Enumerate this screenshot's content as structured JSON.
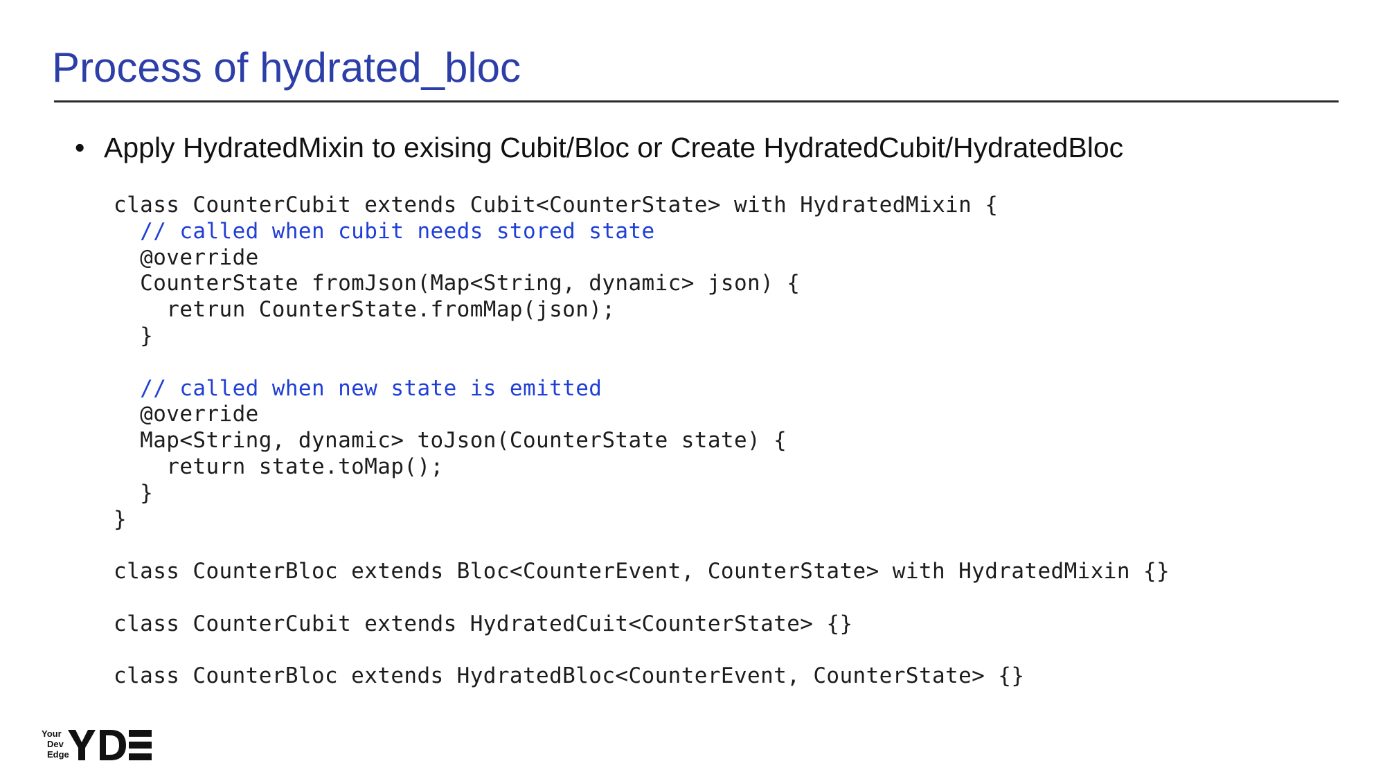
{
  "slide": {
    "title": "Process of hydrated_bloc",
    "bullet": {
      "marker": "•",
      "text": "Apply HydratedMixin to exising Cubit/Bloc or Create HydratedCubit/HydratedBloc"
    }
  },
  "code": {
    "comment_color": "#1f3fd6",
    "lines": [
      {
        "text": "class CounterCubit extends Cubit<CounterState> with HydratedMixin {",
        "comment": false
      },
      {
        "text": "  // called when cubit needs stored state",
        "comment": true
      },
      {
        "text": "  @override",
        "comment": false
      },
      {
        "text": "  CounterState fromJson(Map<String, dynamic> json) {",
        "comment": false
      },
      {
        "text": "    retrun CounterState.fromMap(json);",
        "comment": false
      },
      {
        "text": "  }",
        "comment": false
      },
      {
        "text": "",
        "comment": false
      },
      {
        "text": "  // called when new state is emitted",
        "comment": true
      },
      {
        "text": "  @override",
        "comment": false
      },
      {
        "text": "  Map<String, dynamic> toJson(CounterState state) {",
        "comment": false
      },
      {
        "text": "    return state.toMap();",
        "comment": false
      },
      {
        "text": "  }",
        "comment": false
      },
      {
        "text": "}",
        "comment": false
      },
      {
        "text": "",
        "comment": false
      },
      {
        "text": "class CounterBloc extends Bloc<CounterEvent, CounterState> with HydratedMixin {}",
        "comment": false
      },
      {
        "text": "",
        "comment": false
      },
      {
        "text": "class CounterCubit extends HydratedCuit<CounterState> {}",
        "comment": false
      },
      {
        "text": "",
        "comment": false
      },
      {
        "text": "class CounterBloc extends HydratedBloc<CounterEvent, CounterState> {}",
        "comment": false
      }
    ]
  },
  "logo": {
    "words": [
      "Your",
      "Dev",
      "Edge"
    ],
    "mark": "YDE"
  }
}
